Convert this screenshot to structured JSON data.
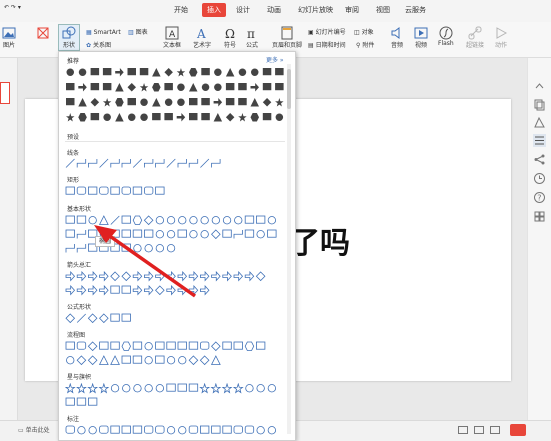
{
  "ribbon_tabs": [
    {
      "label": "开始",
      "active": false
    },
    {
      "label": "插入",
      "active": true
    },
    {
      "label": "设计",
      "active": false
    },
    {
      "label": "动画",
      "active": false
    },
    {
      "label": "幻灯片放映",
      "active": false
    },
    {
      "label": "审阅",
      "active": false
    },
    {
      "label": "视图",
      "active": false
    },
    {
      "label": "云服务",
      "active": false
    }
  ],
  "ribbon": {
    "picture": "图片",
    "shape": "形状",
    "smartart": "SmartArt",
    "chart": "图表",
    "relation": "关系图",
    "textbox": "文本框",
    "wordart": "艺术字",
    "symbol": "符号",
    "formula": "公式",
    "header_footer": "页眉和页脚",
    "slide_number": "幻灯片编号",
    "object": "对象",
    "datetime": "日期和时间",
    "attachment": "附件",
    "audio": "音频",
    "video": "视频",
    "flash": "Flash",
    "hyperlink": "超链接",
    "action": "动作"
  },
  "popup": {
    "recommend": "推荐",
    "more": "更多 »",
    "preset": "预设",
    "sections": [
      {
        "title": "线条"
      },
      {
        "title": "矩形"
      },
      {
        "title": "基本形状"
      },
      {
        "title": "箭头总汇"
      },
      {
        "title": "公式形状"
      },
      {
        "title": "流程图"
      },
      {
        "title": "星与旗帜"
      },
      {
        "title": "标注"
      }
    ],
    "tooltip": "椭圆"
  },
  "slide": {
    "text": "了吗"
  },
  "status": {
    "notes_placeholder": "单击此处"
  },
  "colors": {
    "accent": "#e8463a",
    "arrow": "#e02020",
    "icon_blue": "#3d6fb6"
  }
}
